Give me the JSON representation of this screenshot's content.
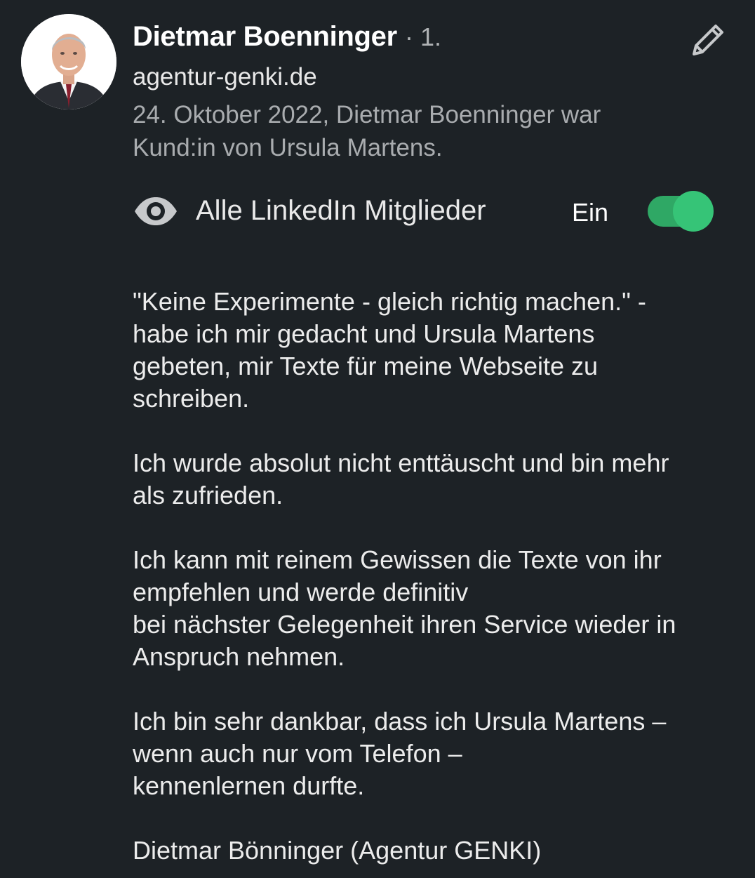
{
  "author": {
    "name": "Dietmar Boenninger",
    "degree": "· 1.",
    "headline": "agentur-genki.de",
    "meta_lines": [
      "24. Oktober 2022, Dietmar Boenninger war",
      "Kund:in von Ursula Martens."
    ]
  },
  "icons": {
    "avatar": "profile-photo",
    "edit": "pencil-icon",
    "visibility": "eye-icon"
  },
  "visibility": {
    "label": "Alle LinkedIn Mitglieder",
    "state_label": "Ein",
    "enabled": true
  },
  "colors": {
    "background": "#1d2226",
    "toggle_on": "#36c477",
    "muted_text": "#a9acaf"
  },
  "recommendation": {
    "paragraphs": [
      [
        "\"Keine Experimente - gleich richtig machen.\" -",
        "habe ich mir gedacht und Ursula Martens",
        "gebeten, mir Texte für meine Webseite zu",
        "schreiben."
      ],
      [
        "Ich wurde absolut nicht enttäuscht und bin mehr",
        "als zufrieden."
      ],
      [
        "Ich kann mit reinem Gewissen die Texte von ihr",
        "empfehlen und werde definitiv",
        "bei nächster Gelegenheit ihren Service wieder in",
        "Anspruch nehmen."
      ],
      [
        "Ich bin sehr dankbar, dass ich Ursula Martens –",
        "wenn auch nur vom Telefon –",
        "kennenlernen durfte."
      ]
    ],
    "signature": "Dietmar Bönninger (Agentur GENKI)"
  }
}
